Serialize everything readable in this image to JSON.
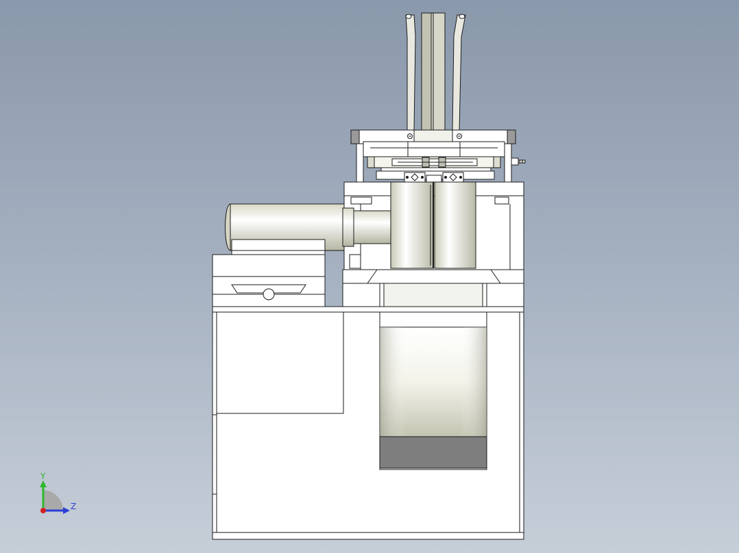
{
  "viewport": {
    "background_top": "#8a98ab",
    "background_bottom": "#c6ced8"
  },
  "triad": {
    "y_label": "Y",
    "z_label": "Z",
    "y_color": "#2db82d",
    "z_color": "#2b3fd6",
    "x_color": "#d42020"
  },
  "model": {
    "line_color": "#1a1a1a",
    "face_color": "#ffffff",
    "shade_color": "#7e7e7e"
  }
}
